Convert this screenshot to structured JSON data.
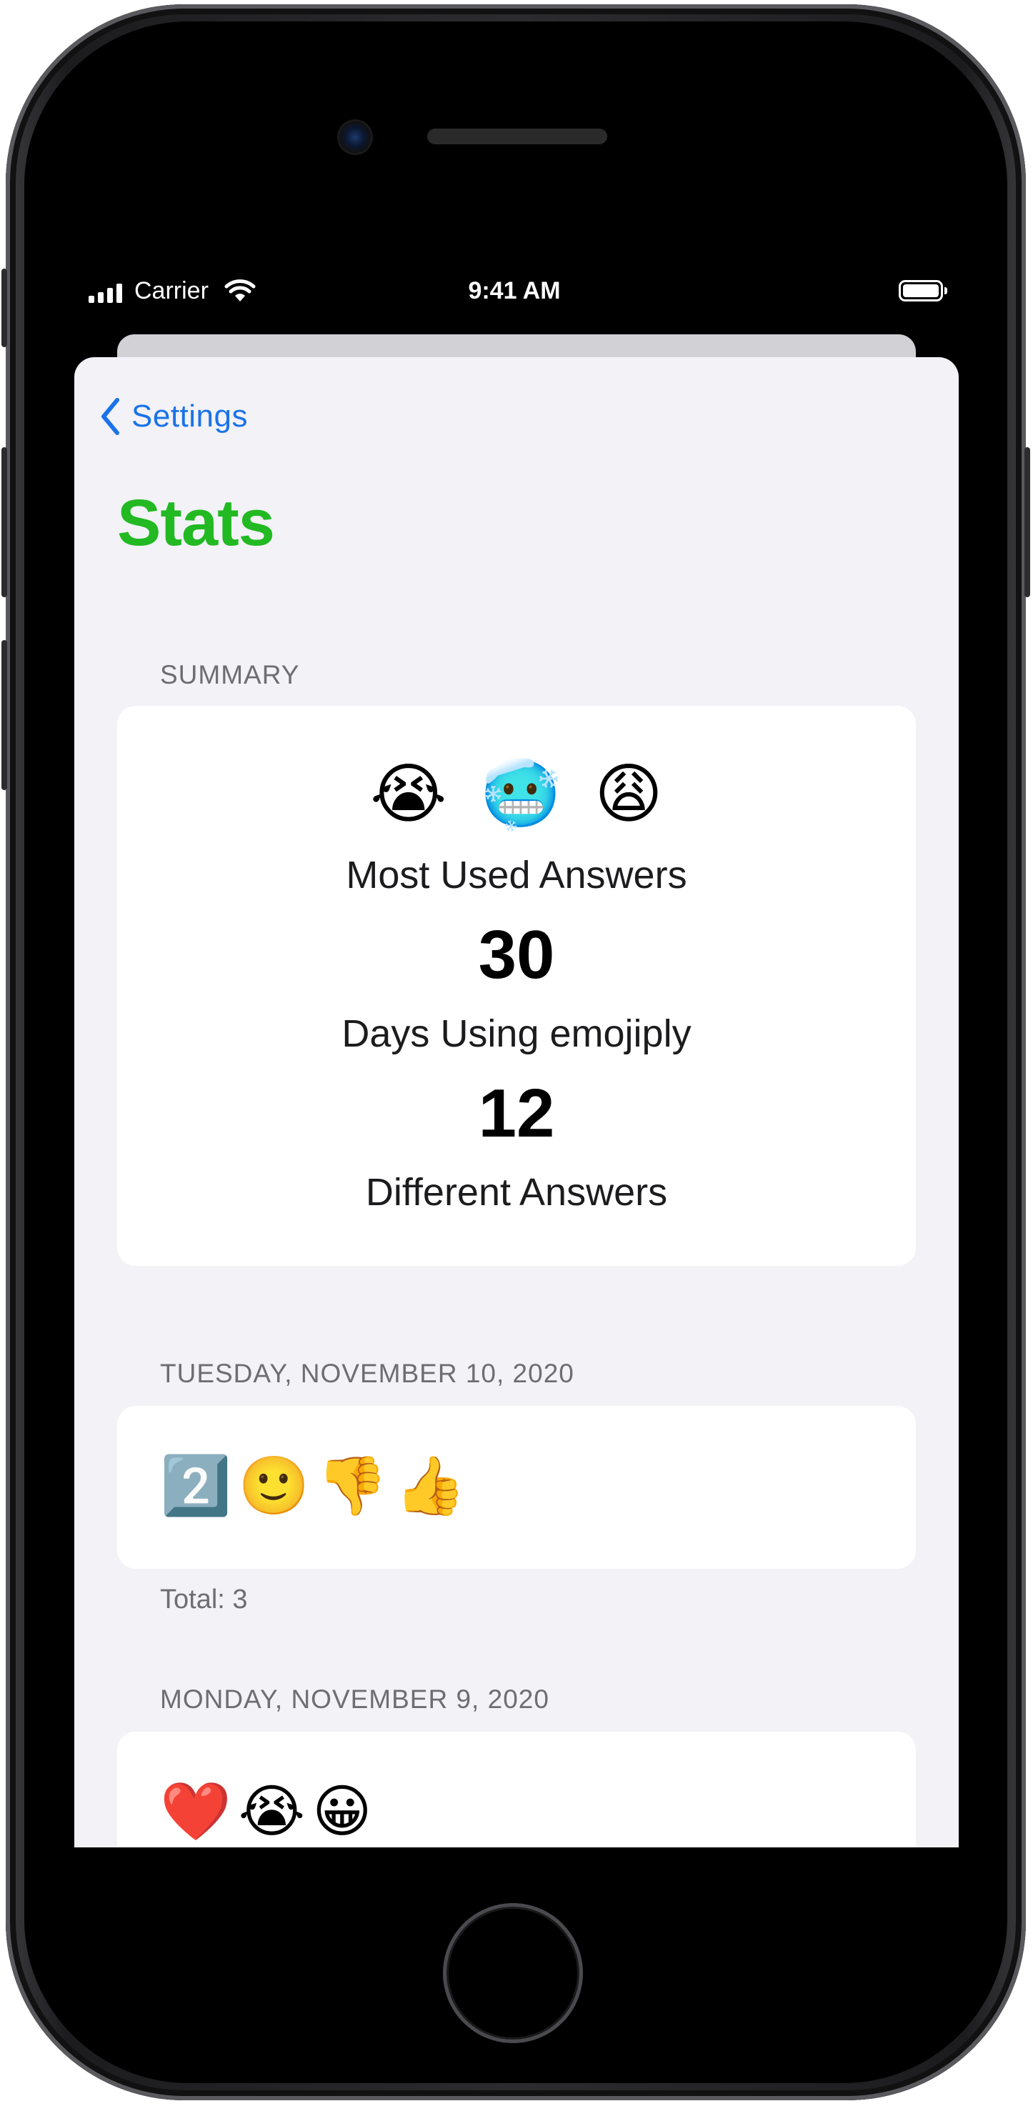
{
  "status_bar": {
    "carrier": "Carrier",
    "time": "9:41 AM"
  },
  "nav": {
    "back_label": "Settings"
  },
  "page": {
    "title": "Stats"
  },
  "colors": {
    "title_green": "#22b922",
    "link_blue": "#1a73e8"
  },
  "summary": {
    "header": "SUMMARY",
    "most_used_emojis": [
      "😭",
      "🥶",
      "😩"
    ],
    "most_used_label": "Most Used Answers",
    "days_value": "30",
    "days_label": "Days Using emojiply",
    "answers_value": "12",
    "answers_label": "Different Answers"
  },
  "days": [
    {
      "header": "TUESDAY, NOVEMBER 10, 2020",
      "emojis": [
        "2️⃣",
        "🙂",
        "👎",
        "👍"
      ],
      "total": "Total: 3"
    },
    {
      "header": "MONDAY, NOVEMBER 9, 2020",
      "emojis": [
        "❤️",
        "😭",
        "😀"
      ]
    }
  ]
}
